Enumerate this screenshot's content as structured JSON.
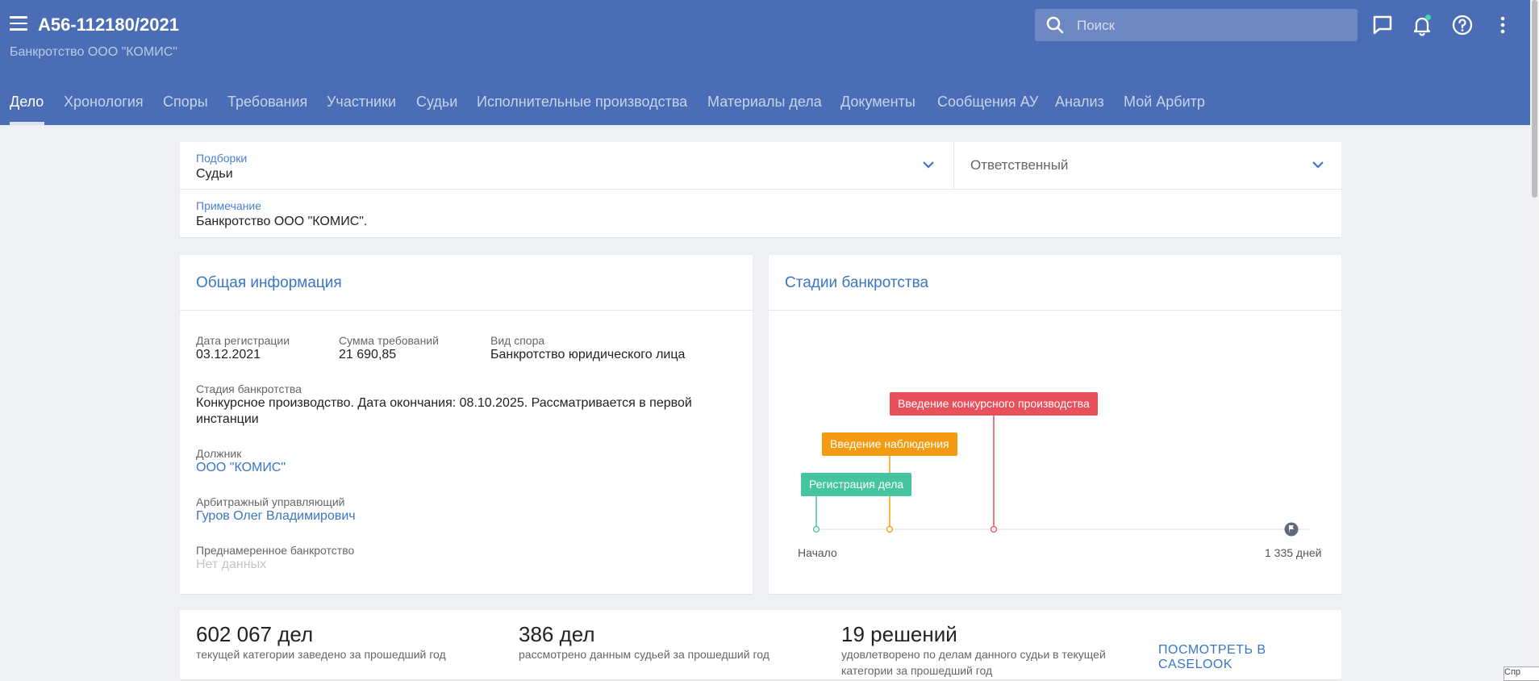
{
  "header": {
    "case_number": "А56-112180/2021",
    "case_subtitle": "Банкротство ООО \"КОМИС\"",
    "search_placeholder": "Поиск",
    "tabs": [
      "Дело",
      "Хронология",
      "Споры",
      "Требования",
      "Участники",
      "Судьи",
      "Исполнительные производства",
      "Материалы дела",
      "Документы",
      "Сообщения АУ",
      "Анализ",
      "Мой Арбитр"
    ],
    "active_tab": "Дело"
  },
  "filters": {
    "collection_label": "Подборки",
    "collection_value": "Судьи",
    "responsible_placeholder": "Ответственный",
    "note_label": "Примечание",
    "note_value": "Банкротство ООО \"КОМИС\"."
  },
  "general_info": {
    "title": "Общая информация",
    "reg_date_label": "Дата регистрации",
    "reg_date_value": "03.12.2021",
    "claims_label": "Сумма требований",
    "claims_value": "21 690,85",
    "dispute_label": "Вид спора",
    "dispute_value": "Банкротство юридического лица",
    "stage_label": "Стадия банкротства",
    "stage_value": "Конкурсное производство. Дата окончания: 08.10.2025. Рассматривается в первой инстанции",
    "debtor_label": "Должник",
    "debtor_value": "ООО \"КОМИС\"",
    "manager_label": "Арбитражный управляющий",
    "manager_value": "Гуров Олег Владимирович",
    "deliberate_label": "Преднамеренное банкротство",
    "deliberate_value": "Нет данных"
  },
  "stages": {
    "title": "Стадии банкротства",
    "start_label": "Начало",
    "end_label": "1 335 дней",
    "items": [
      {
        "label": "Регистрация дела",
        "color": "#45c4a0"
      },
      {
        "label": "Введение наблюдения",
        "color": "#f39c12"
      },
      {
        "label": "Введение конкурсного производства",
        "color": "#e8505b"
      }
    ]
  },
  "stats": {
    "items": [
      {
        "value": "602 067 дел",
        "desc": "текущей категории заведено за прошедший год"
      },
      {
        "value": "386 дел",
        "desc": "рассмотрено данным судьей за прошедший год"
      },
      {
        "value": "19 решений",
        "desc": "удовлетворено по делам данного судьи в текущей категории за прошедший год"
      }
    ],
    "link": "ПОСМОТРЕТЬ В CASELOOK"
  },
  "corner_button": "Спр",
  "colors": {
    "header": "#4a6db5",
    "accent": "#3b75c4"
  }
}
